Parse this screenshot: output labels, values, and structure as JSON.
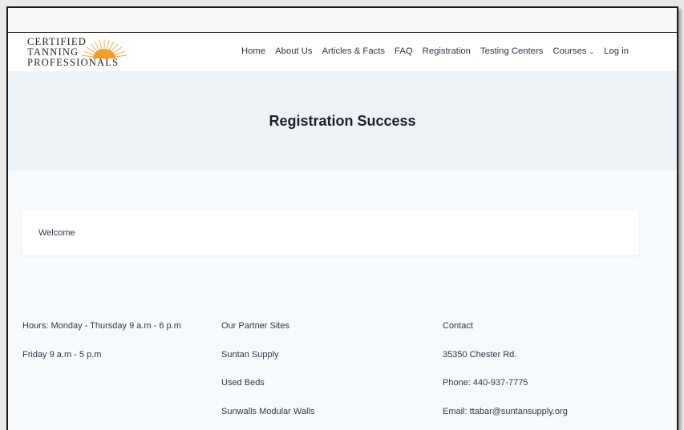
{
  "logo": {
    "line1": "CERTIFIED",
    "line2": "TANNING",
    "line3": "PROFESSIONALS",
    "sun_color": "#f4a43a"
  },
  "nav": {
    "items": [
      "Home",
      "About Us",
      "Articles & Facts",
      "FAQ",
      "Registration",
      "Testing Centers",
      "Courses",
      "Log in"
    ],
    "courses_icon": "chevron-down-icon"
  },
  "hero": {
    "title": "Registration Success"
  },
  "card": {
    "text": "Welcome"
  },
  "footer": {
    "hours": [
      "Hours: Monday - Thursday 9 a.m - 6 p.m",
      "Friday 9 a.m - 5 p.m"
    ],
    "partners": [
      "Our Partner Sites",
      "Suntan Supply",
      "Used Beds",
      "Sunwalls Modular Walls"
    ],
    "contact": [
      "Contact",
      "35350 Chester Rd.",
      "Phone: 440-937-7775",
      "Email: ttabar@suntansupply.org"
    ]
  },
  "colors": {
    "hero_bg": "#edf2f7",
    "content_bg": "#f7fafc",
    "text": "#2d3748"
  }
}
